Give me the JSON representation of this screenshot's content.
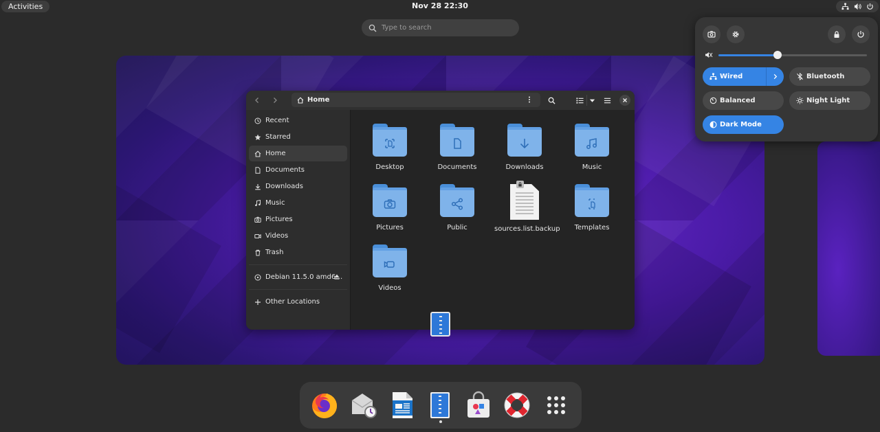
{
  "topbar": {
    "activities_label": "Activities",
    "clock": "Nov 28  22:30",
    "tray_icons": [
      "network-wired-icon",
      "volume-icon",
      "power-icon"
    ]
  },
  "search": {
    "placeholder": "Type to search"
  },
  "files_window": {
    "path_label": "Home",
    "sidebar": [
      {
        "label": "Recent",
        "icon": "clock-icon"
      },
      {
        "label": "Starred",
        "icon": "star-icon"
      },
      {
        "label": "Home",
        "icon": "home-icon",
        "active": true
      },
      {
        "label": "Documents",
        "icon": "document-icon"
      },
      {
        "label": "Downloads",
        "icon": "download-icon"
      },
      {
        "label": "Music",
        "icon": "music-icon"
      },
      {
        "label": "Pictures",
        "icon": "camera-icon"
      },
      {
        "label": "Videos",
        "icon": "video-icon"
      },
      {
        "label": "Trash",
        "icon": "trash-icon"
      }
    ],
    "devices": [
      {
        "label": "Debian 11.5.0 amd6…",
        "icon": "disc-icon"
      }
    ],
    "other_locations": "Other Locations",
    "files": [
      {
        "name": "Desktop",
        "icon": "desktop-icon",
        "kind": "folder"
      },
      {
        "name": "Documents",
        "icon": "document-icon",
        "kind": "folder"
      },
      {
        "name": "Downloads",
        "icon": "download-icon",
        "kind": "folder"
      },
      {
        "name": "Music",
        "icon": "music-icon",
        "kind": "folder"
      },
      {
        "name": "Pictures",
        "icon": "camera-icon",
        "kind": "folder"
      },
      {
        "name": "Public",
        "icon": "share-icon",
        "kind": "folder"
      },
      {
        "name": "sources.list.backup",
        "icon": "text-file-icon",
        "kind": "file"
      },
      {
        "name": "Templates",
        "icon": "template-icon",
        "kind": "folder"
      },
      {
        "name": "Videos",
        "icon": "video-icon",
        "kind": "folder"
      }
    ]
  },
  "quick_settings": {
    "volume_level": 0.4,
    "tiles": {
      "wired": "Wired",
      "bluetooth": "Bluetooth",
      "balanced": "Balanced",
      "night_light": "Night Light",
      "dark_mode": "Dark Mode"
    },
    "accent_color": "#3584e4"
  },
  "dock": {
    "apps": [
      "firefox-icon",
      "evolution-mail-icon",
      "libreoffice-writer-icon",
      "file-archiver-icon",
      "software-store-icon",
      "help-icon",
      "app-grid-icon"
    ]
  }
}
